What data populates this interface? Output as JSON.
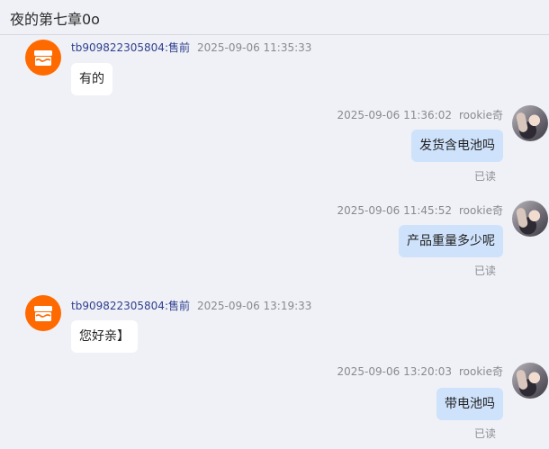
{
  "header": {
    "title": "夜的第七章0o"
  },
  "messages": [
    {
      "side": "left",
      "sender": "tb909822305804:售前",
      "time": "2025-09-06 11:35:33",
      "text": "有的"
    },
    {
      "side": "right",
      "sender": "rookie奇",
      "time": "2025-09-06 11:36:02",
      "text": "发货含电池吗",
      "status": "已读"
    },
    {
      "side": "right",
      "sender": "rookie奇",
      "time": "2025-09-06 11:45:52",
      "text": "产品重量多少呢",
      "status": "已读"
    },
    {
      "side": "left",
      "sender": "tb909822305804:售前",
      "time": "2025-09-06 13:19:33",
      "text": "您好亲】"
    },
    {
      "side": "right",
      "sender": "rookie奇",
      "time": "2025-09-06 13:20:03",
      "text": "带电池吗",
      "status": "已读"
    }
  ],
  "icons": {
    "seller_avatar": "shop-icon",
    "user_avatar": "user-photo"
  },
  "colors": {
    "seller_avatar_bg": "#ff6a00",
    "my_bubble_bg": "#cfe2fb",
    "their_bubble_bg": "#ffffff",
    "sender_name": "#2f3f8f"
  }
}
